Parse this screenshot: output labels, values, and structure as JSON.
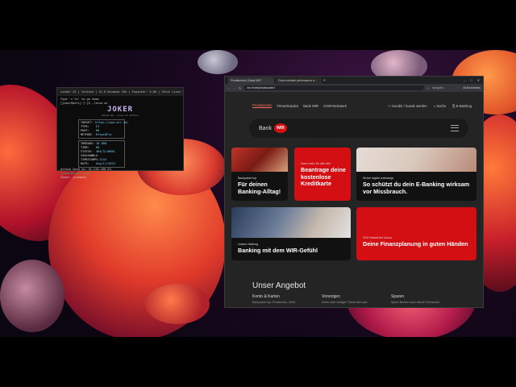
{
  "terminal": {
    "title": "Leader 25 | Intense | 51.8 Windows 104 | Engineer: 9.06 | Fetch Linux 9.6...",
    "cmd1": "Type 'c'to' to go home",
    "cmd2": "[joker@kali]:[~]$ ./zeno.sh",
    "logo": "JOKER",
    "subtitle": "phish me, click on button",
    "fields": [
      {
        "k": "TARGET:",
        "v": "https://www.wir.ch/"
      },
      {
        "k": "TYPE:",
        "v": "EI"
      },
      {
        "k": "PORT:",
        "v": "80"
      },
      {
        "k": "METHOD:",
        "v": "HttpsGFlo"
      }
    ],
    "fields2": [
      {
        "k": "THREADS:",
        "v": "10 000"
      },
      {
        "k": "TIME:",
        "v": "60"
      },
      {
        "k": "STATUS:",
        "v": "404/3/10001"
      },
      {
        "k": "COOLDOWN:",
        "v": "0"
      },
      {
        "k": "TIMESTAMP:",
        "v": "1.2144"
      },
      {
        "k": "DATE:",
        "v": "Aug/17/2023"
      }
    ],
    "attack_line": "Attack Send to: 51.210.166.63",
    "prompt_line": "[joker@kali]:[~]$",
    "status_line": "Steps: [Loaded]"
  },
  "browser": {
    "tabs": [
      "Privatkunden | Bank WIR",
      "Check website performance a..."
    ],
    "url": "wir.ch/de/privatkunden/",
    "bookmarks_label": "All Bookmarks",
    "incognito_label": "Inkognito"
  },
  "site": {
    "nav": [
      "Privatkunden",
      "Firmenkunden",
      "Bank WIR",
      "CHW-Netzwerk"
    ],
    "nav_right": [
      "Kundin / Kunde werden",
      "Suche",
      "E-Banking"
    ],
    "brand_text": "Bank",
    "brand_badge": "WIR",
    "cards": [
      {
        "kicker": "Bankpaket top",
        "title": "Für deinen Banking-Alltag!"
      },
      {
        "kicker": "Noch mehr für dich drin",
        "title": "Beantrage deine kostenlose Kreditkarte"
      },
      {
        "kicker": "Sicher digital unterwegs",
        "title": "So schützt du dein E-Banking wirksam vor Missbrauch."
      },
      {
        "kicker": "Unsere Haltung",
        "title": "Banking mit dem WIR-Gefühl"
      },
      {
        "kicker": "20% Rabatt bei Caveo",
        "title": "Deine Finanzplanung in guten Händen"
      }
    ],
    "section_title": "Unser Angebot",
    "columns": [
      {
        "title": "Konto & Karten",
        "desc": "Bankpaket top: Privatkonto, Debit"
      },
      {
        "title": "Vorsorgen",
        "desc": "Konto oder Anlage? Sicherheit oder"
      },
      {
        "title": "Sparen",
        "desc": "Spare flexibel nach deinen Wünschen"
      }
    ]
  },
  "colors": {
    "brand_red": "#d40f14",
    "nav_active": "#ff6b5a"
  }
}
